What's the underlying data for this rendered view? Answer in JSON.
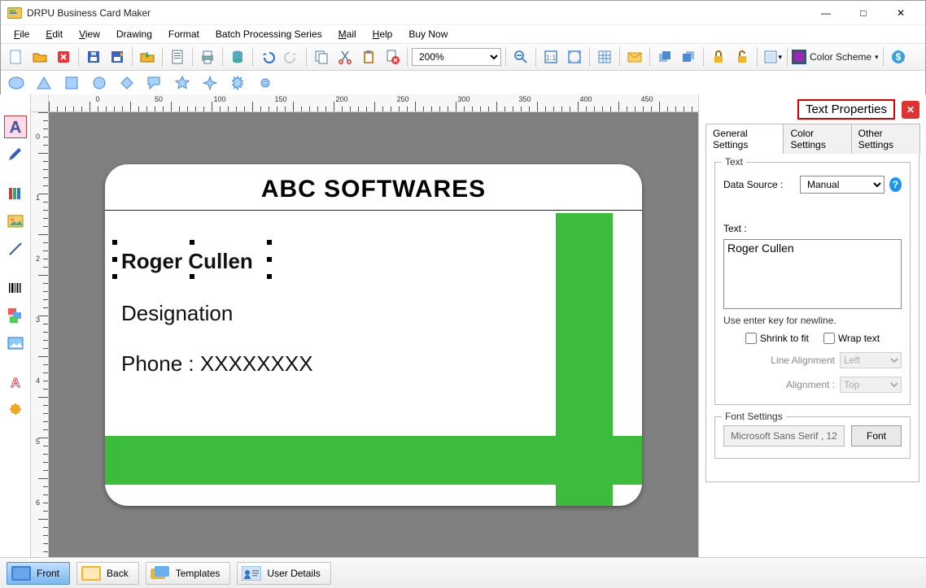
{
  "app": {
    "title": "DRPU Business Card Maker"
  },
  "menu": {
    "file": "File",
    "edit": "Edit",
    "view": "View",
    "drawing": "Drawing",
    "format": "Format",
    "batch": "Batch Processing Series",
    "mail": "Mail",
    "help": "Help",
    "buy": "Buy Now"
  },
  "toolbar": {
    "zoom": "200%",
    "color_scheme": "Color Scheme"
  },
  "card": {
    "title": "ABC SOFTWARES",
    "name": "Roger Cullen",
    "designation": "Designation",
    "phone": "Phone : XXXXXXXX"
  },
  "bottom": {
    "front": "Front",
    "back": "Back",
    "templates": "Templates",
    "user_details": "User Details"
  },
  "properties": {
    "title": "Text Properties",
    "tabs": {
      "general": "General Settings",
      "color": "Color Settings",
      "other": "Other Settings"
    },
    "text_group": "Text",
    "data_source_label": "Data Source :",
    "data_source_value": "Manual",
    "text_label": "Text :",
    "text_value": "Roger Cullen",
    "hint": "Use enter key for newline.",
    "shrink": "Shrink to fit",
    "wrap": "Wrap text",
    "line_alignment_label": "Line Alignment",
    "line_alignment_value": "Left",
    "alignment_label": "Alignment :",
    "alignment_value": "Top",
    "font_settings": "Font Settings",
    "font_display": "Microsoft Sans Serif , 12",
    "font_button": "Font"
  },
  "ruler": {
    "labels": [
      "0",
      "50",
      "100",
      "150",
      "200",
      "250",
      "300",
      "350",
      "400",
      "450"
    ]
  }
}
